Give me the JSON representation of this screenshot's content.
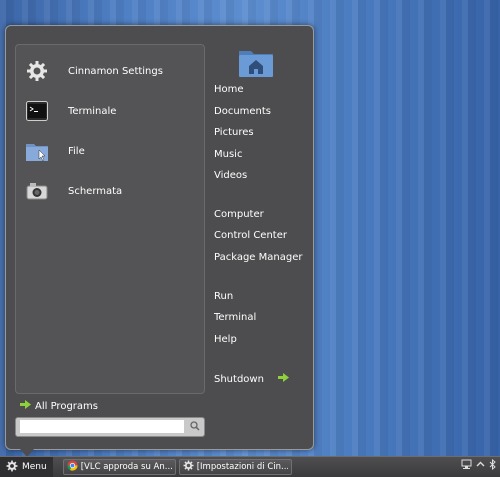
{
  "favorites": [
    {
      "label": "Cinnamon Settings",
      "icon": "gear-icon"
    },
    {
      "label": "Terminale",
      "icon": "terminal-icon"
    },
    {
      "label": "File",
      "icon": "folder-icon"
    },
    {
      "label": "Schermata",
      "icon": "camera-icon"
    }
  ],
  "places": {
    "home": "Home",
    "documents": "Documents",
    "pictures": "Pictures",
    "music": "Music",
    "videos": "Videos"
  },
  "system": {
    "computer": "Computer",
    "control_center": "Control Center",
    "package_manager": "Package Manager"
  },
  "actions": {
    "run": "Run",
    "terminal": "Terminal",
    "help": "Help",
    "shutdown": "Shutdown"
  },
  "all_programs": "All Programs",
  "search": {
    "value": "",
    "placeholder": ""
  },
  "panel": {
    "menu_label": "Menu",
    "tasks": [
      {
        "label": "[VLC approda su An...",
        "icon": "chrome-icon"
      },
      {
        "label": "[Impostazioni di Cin...",
        "icon": "gear-icon"
      }
    ]
  },
  "colors": {
    "accent_arrow": "#8fd13b",
    "menu_bg": "#4d4d4f",
    "desktop": "#4f7fc4"
  }
}
